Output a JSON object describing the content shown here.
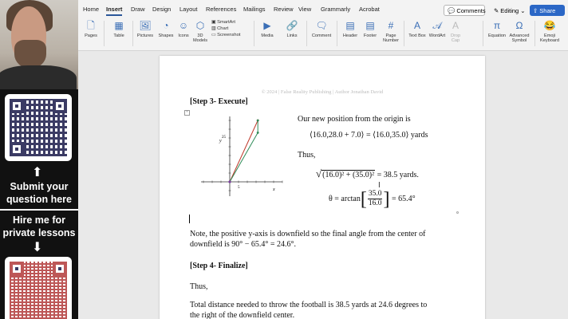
{
  "sidebar": {
    "cta_question": "Submit your question here",
    "cta_lessons": "Hire me for private lessons",
    "arrow_up": "⬆",
    "arrow_down": "⬇"
  },
  "ribbon": {
    "tabs": [
      {
        "label": "Home"
      },
      {
        "label": "Insert"
      },
      {
        "label": "Draw"
      },
      {
        "label": "Design"
      },
      {
        "label": "Layout"
      },
      {
        "label": "References"
      },
      {
        "label": "Mailings"
      },
      {
        "label": "Review"
      },
      {
        "label": "View"
      },
      {
        "label": "Grammarly"
      },
      {
        "label": "Acrobat"
      }
    ],
    "active_tab": "Insert",
    "comments_label": "Comments",
    "editing_label": "Editing",
    "share_label": "Share",
    "tools": {
      "pages": "Pages",
      "table": "Table",
      "pictures": "Pictures",
      "shapes": "Shapes",
      "icons": "Icons",
      "models_3d": "3D Models",
      "smartart": "SmartArt",
      "chart": "Chart",
      "screenshot": "Screenshot",
      "media": "Media",
      "links": "Links",
      "comment": "Comment",
      "header": "Header",
      "footer": "Footer",
      "page_number": "Page Number",
      "text_box": "Text Box",
      "wordart": "WordArt",
      "drop_cap": "Drop Cap",
      "equation": "Equation",
      "advanced_symbol": "Advanced Symbol",
      "emoji_keyboard": "Emoji Keyboard"
    },
    "colors": {
      "accent": "#2b579a",
      "share": "#2b67c6"
    }
  },
  "document": {
    "watermark": "© 2024 | False Reality Publishing | Author Jonathan David",
    "step3_title": "[Step 3- Execute]",
    "new_position_text": "Our new position from the origin is",
    "position_eq": "⟨16.0,28.0 + 7.0⟩ = ⟨16.0,35.0⟩ yards",
    "thus1": "Thus,",
    "magnitude_radicand": "(16.0)² + (35.0)²",
    "magnitude_result": "= 38.5 yards.",
    "theta_label": "θ = arctan",
    "theta_num": "35.0",
    "theta_den": "16.0",
    "theta_result": "= 65.4°",
    "note_line1": "Note, the positive y-axis is downfield so the final angle from the center of",
    "note_line2": "downfield is 90° − 65.4° = 24.6°.",
    "step4_title": "[Step 4- Finalize]",
    "thus2": "Thus,",
    "final_line1": "Total distance needed to throw the football is 38.5 yards at 24.6 degrees to",
    "final_line2": "the right of the downfield center."
  },
  "chart_data": {
    "type": "line",
    "xlabel": "x",
    "ylabel": "y",
    "y_tick_labels": [
      "25"
    ],
    "x_tick_labels": [
      "5"
    ],
    "series": [
      {
        "color": "#c0392b",
        "x": [
          0,
          16.0
        ],
        "y": [
          0,
          35.0
        ]
      },
      {
        "color": "#2e8b57",
        "x": [
          0,
          16.0
        ],
        "y": [
          0,
          28.0
        ]
      },
      {
        "color": "#2e8b57",
        "x": [
          16.0,
          16.0
        ],
        "y": [
          28.0,
          35.0
        ]
      }
    ]
  }
}
